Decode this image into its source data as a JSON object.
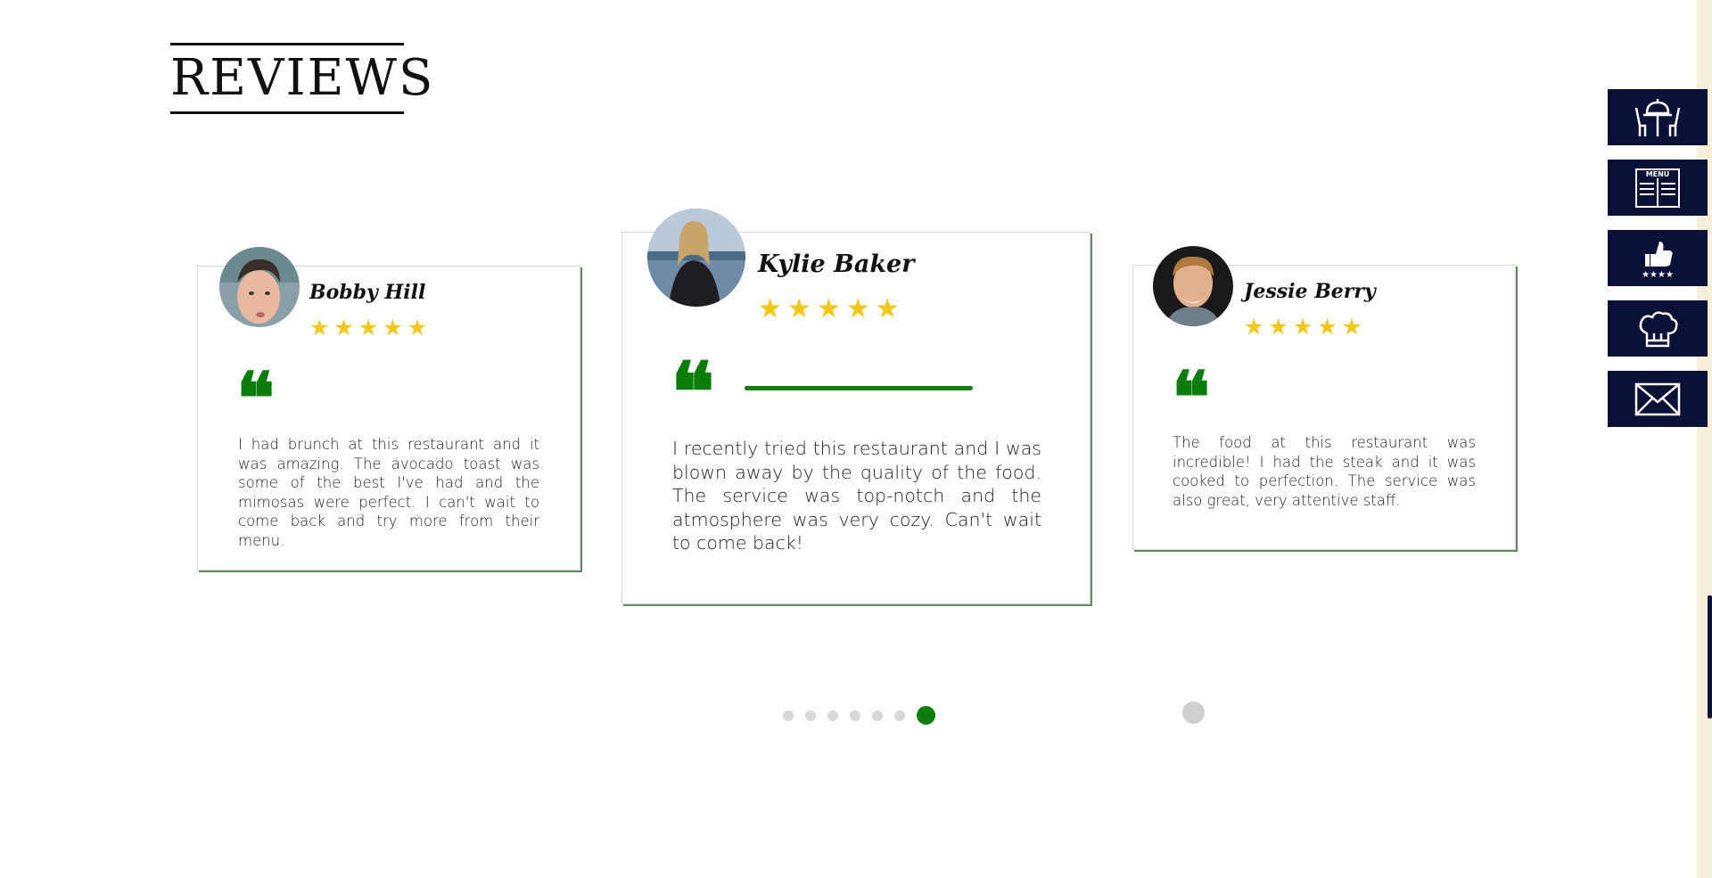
{
  "section": {
    "title": "REVIEWS"
  },
  "reviews": [
    {
      "name": "Bobby Hill",
      "rating": 5,
      "stars": "★★★★★",
      "quote_mark": "❝",
      "text": "I had brunch at this restaurant and it was amazing. The avocado toast was some of the best I've had and the mimosas were perfect. I can't wait to come back and try more from their menu."
    },
    {
      "name": "Kylie Baker",
      "rating": 5,
      "stars": "★★★★★",
      "quote_mark": "❝",
      "text": "I recently tried this restaurant and I was blown away by the quality of the food. The service was top-notch and the atmosphere was very cozy. Can't wait to come back!"
    },
    {
      "name": "Jessie Berry",
      "rating": 5,
      "stars": "★★★★★",
      "quote_mark": "❝",
      "text": "The food at this restaurant was incredible! I had the steak and it was cooked to perfection. The service was also great, very attentive staff."
    }
  ],
  "pagination": {
    "total_dots": 7,
    "active_index": 6
  },
  "sidenav": {
    "items": [
      {
        "icon": "table-service-icon"
      },
      {
        "icon": "menu-book-icon",
        "label": "MENU"
      },
      {
        "icon": "thumbs-up-rating-icon",
        "stars": "★★★★"
      },
      {
        "icon": "chef-hat-icon"
      },
      {
        "icon": "envelope-icon"
      }
    ]
  },
  "colors": {
    "accent_green": "#0b7d0b",
    "star_yellow": "#f5c518",
    "nav_navy": "#0b1036",
    "scroll_track": "#f6efd9"
  }
}
